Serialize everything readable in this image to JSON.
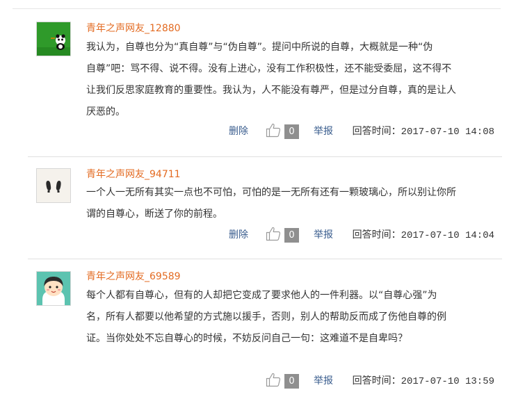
{
  "comments": [
    {
      "username": "青年之声网友_12880",
      "avatar": "panda-avatar",
      "lines": [
        "我认为，自尊也分为“真自尊”与“伪自尊”。提问中所说的自尊，大概就是一种“伪",
        "自尊”吧：骂不得、说不得。没有上进心，没有工作积极性，还不能受委屈，这不得不",
        "让我们反思家庭教育的重要性。我认为，人不能没有尊严，但是过分自尊，真的是让人",
        "厌恶的。"
      ],
      "delete_label": "删除",
      "like_count": "0",
      "report_label": "举报",
      "time_label": "回答时间：",
      "time_value": "2017-07-10 14:08"
    },
    {
      "username": "青年之声网友_94711",
      "avatar": "footprints-avatar",
      "lines": [
        "一个人一无所有其实一点也不可怕，可怕的是一无所有还有一颗玻璃心，所以别让你所",
        "谓的自尊心，断送了你的前程。"
      ],
      "delete_label": "删除",
      "like_count": "0",
      "report_label": "举报",
      "time_label": "回答时间：",
      "time_value": "2017-07-10 14:04"
    },
    {
      "username": "青年之声网友_69589",
      "avatar": "cartoon-boy-avatar",
      "lines": [
        "每个人都有自尊心，但有的人却把它变成了要求他人的一件利器。以“自尊心强”为",
        "名，所有人都要以他希望的方式施以援手，否则，别人的帮助反而成了伤他自尊的例",
        "证。当你处处不忘自尊心的时候，不妨反问自己一句：这难道不是自卑吗？"
      ],
      "like_count": "0",
      "report_label": "举报",
      "time_label": "回答时间：",
      "time_value": "2017-07-10 13:59"
    }
  ],
  "colors": {
    "username": "#e36b22",
    "link": "#3a5d8e",
    "badge": "#8f8f8f",
    "divider": "#e0e0e0"
  },
  "icons": {
    "like": "thumbs-up-icon"
  }
}
